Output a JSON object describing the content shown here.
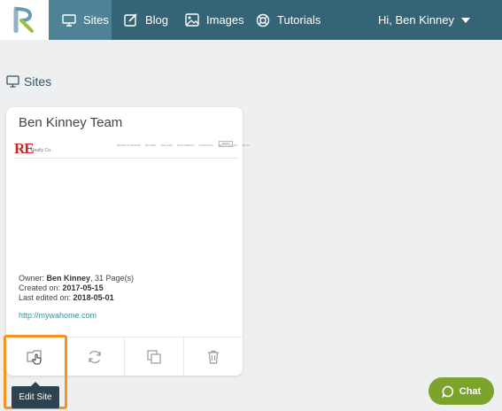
{
  "nav": {
    "items": [
      {
        "label": "Sites",
        "icon": "monitor-icon"
      },
      {
        "label": "Blog",
        "icon": "edit-icon"
      },
      {
        "label": "Images",
        "icon": "image-icon"
      },
      {
        "label": "Tutorials",
        "icon": "lifebuoy-icon"
      }
    ],
    "active": "Sites",
    "user_greeting": "Hi, Ben Kinney"
  },
  "page": {
    "section_title": "Sites"
  },
  "site_card": {
    "title": "Ben Kinney Team",
    "preview": {
      "brand": "RE",
      "brand_sub": "Realty Co.",
      "nav_items": [
        "SEARCH LISTINGS",
        "BUYERS",
        "SELLERS",
        "OUR AGENTS",
        "FINANCING",
        "ABOUT RE/MAX",
        "BLOG"
      ],
      "button_label": "MENU"
    },
    "owner_label": "Owner: ",
    "owner_name": "Ben Kinney",
    "pages_text": ", 31 Page(s)",
    "created_label": "Created on: ",
    "created_date": "2017-05-15",
    "edited_label": "Last edited on: ",
    "edited_date": "2018-05-01",
    "url": "http://mywahome.com",
    "actions": [
      "edit-site",
      "sync",
      "duplicate",
      "delete"
    ]
  },
  "tooltip": {
    "label": "Edit Site"
  },
  "chat": {
    "label": "Chat"
  },
  "colors": {
    "topbar": "#356477",
    "active_nav": "#4e8295",
    "highlight": "#f5931e",
    "chat": "#7ca32c",
    "link": "#3a8b9c"
  }
}
